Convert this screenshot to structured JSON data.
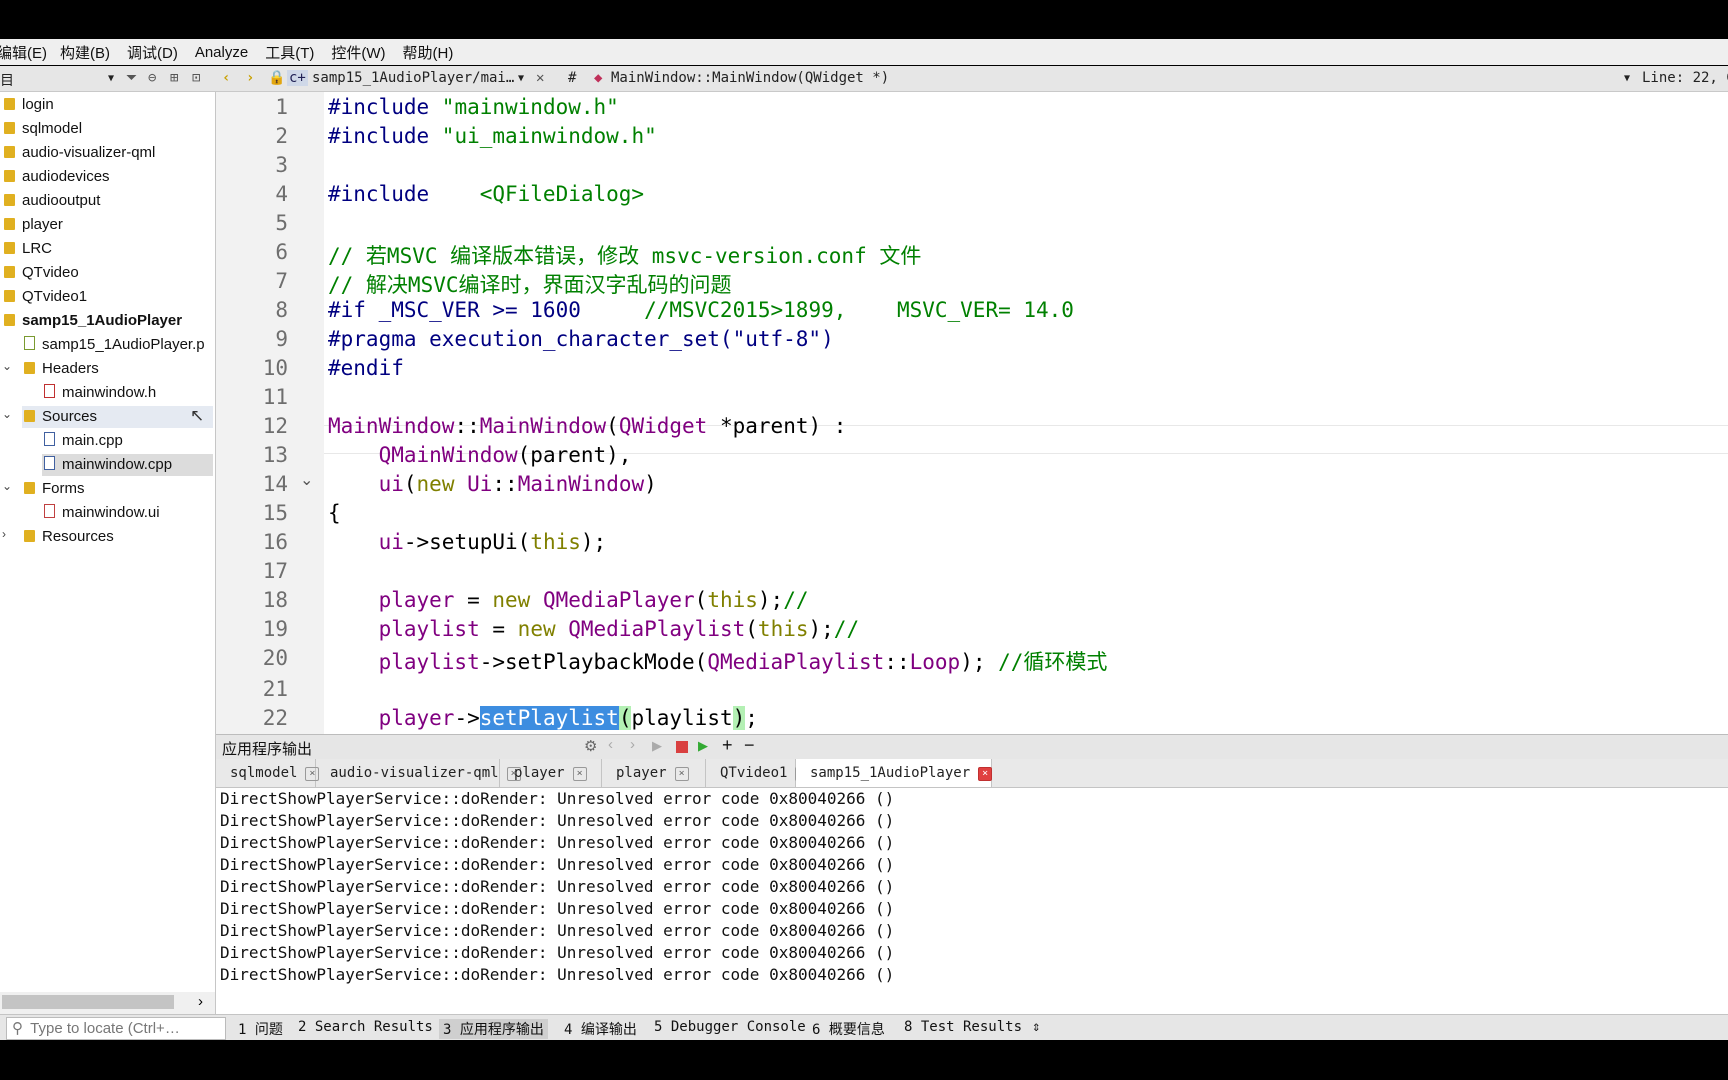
{
  "menu": [
    "编辑(E)",
    "构建(B)",
    "调试(D)",
    "Analyze",
    "工具(T)",
    "控件(W)",
    "帮助(H)"
  ],
  "toolbar": {
    "left_icon": "目",
    "file_tab": "samp15_1AudioPlayer/mai…",
    "hash": "#",
    "symbol": "MainWindow::MainWindow(QWidget *)",
    "position": "Line: 22, C"
  },
  "project_tree": [
    {
      "label": "login",
      "indent": 0,
      "icon": "folder-icon"
    },
    {
      "label": "sqlmodel",
      "indent": 0,
      "icon": "folder-icon"
    },
    {
      "label": "audio-visualizer-qml",
      "indent": 0,
      "icon": "folder-icon"
    },
    {
      "label": "audiodevices",
      "indent": 0,
      "icon": "folder-icon"
    },
    {
      "label": "audiooutput",
      "indent": 0,
      "icon": "folder-icon"
    },
    {
      "label": "player",
      "indent": 0,
      "icon": "folder-icon"
    },
    {
      "label": "LRC",
      "indent": 0,
      "icon": "folder-icon"
    },
    {
      "label": "QTvideo",
      "indent": 0,
      "icon": "folder-icon"
    },
    {
      "label": "QTvideo1",
      "indent": 0,
      "icon": "folder-icon"
    },
    {
      "label": "samp15_1AudioPlayer",
      "indent": 0,
      "icon": "folder-icon",
      "bold": true
    },
    {
      "label": "samp15_1AudioPlayer.p",
      "indent": 1,
      "icon": "pro-file-icon"
    },
    {
      "label": "Headers",
      "indent": 1,
      "icon": "headers-folder-icon",
      "chevron": "expanded"
    },
    {
      "label": "mainwindow.h",
      "indent": 2,
      "icon": "header-file-icon"
    },
    {
      "label": "Sources",
      "indent": 1,
      "icon": "sources-folder-icon",
      "chevron": "expanded",
      "hover": true
    },
    {
      "label": "main.cpp",
      "indent": 2,
      "icon": "cpp-file-icon"
    },
    {
      "label": "mainwindow.cpp",
      "indent": 2,
      "icon": "cpp-file-icon",
      "selected": true
    },
    {
      "label": "Forms",
      "indent": 1,
      "icon": "forms-folder-icon",
      "chevron": "expanded"
    },
    {
      "label": "mainwindow.ui",
      "indent": 2,
      "icon": "ui-file-icon"
    },
    {
      "label": "Resources",
      "indent": 1,
      "icon": "resources-folder-icon",
      "chevron": "collapsed"
    }
  ],
  "code_lines": [
    {
      "n": "1",
      "segs": [
        [
          "pp",
          "#include "
        ],
        [
          "str",
          "\"mainwindow.h\""
        ]
      ]
    },
    {
      "n": "2",
      "segs": [
        [
          "pp",
          "#include "
        ],
        [
          "str",
          "\"ui_mainwindow.h\""
        ]
      ]
    },
    {
      "n": "3",
      "segs": []
    },
    {
      "n": "4",
      "segs": [
        [
          "pp",
          "#include    "
        ],
        [
          "str",
          "<QFileDialog>"
        ]
      ]
    },
    {
      "n": "5",
      "segs": []
    },
    {
      "n": "6",
      "segs": [
        [
          "cm",
          "// 若MSVC 编译版本错误，修改 msvc-version.conf 文件"
        ]
      ]
    },
    {
      "n": "7",
      "segs": [
        [
          "cm",
          "// 解决MSVC编译时，界面汉字乱码的问题"
        ]
      ]
    },
    {
      "n": "8",
      "segs": [
        [
          "pp",
          "#if _MSC_VER >= 1600     "
        ],
        [
          "cm",
          "//MSVC2015>1899,    MSVC_VER= 14.0"
        ]
      ]
    },
    {
      "n": "9",
      "segs": [
        [
          "pp",
          "#pragma execution_character_set(\"utf-8\")"
        ]
      ]
    },
    {
      "n": "10",
      "segs": [
        [
          "pp",
          "#endif"
        ]
      ]
    },
    {
      "n": "11",
      "segs": []
    },
    {
      "n": "12",
      "segs": [
        [
          "ty",
          "MainWindow"
        ],
        [
          "",
          "::"
        ],
        [
          "ty",
          "MainWindow"
        ],
        [
          "",
          "("
        ],
        [
          "ty",
          "QWidget"
        ],
        [
          "",
          " *parent) :"
        ]
      ]
    },
    {
      "n": "13",
      "segs": [
        [
          "",
          "    "
        ],
        [
          "ty",
          "QMainWindow"
        ],
        [
          "",
          "(parent),"
        ]
      ]
    },
    {
      "n": "14",
      "segs": [
        [
          "",
          "    "
        ],
        [
          "ty",
          "ui"
        ],
        [
          "",
          "("
        ],
        [
          "kw",
          "new "
        ],
        [
          "ty",
          "Ui"
        ],
        [
          "",
          "::"
        ],
        [
          "ty",
          "MainWindow"
        ],
        [
          "",
          ")"
        ]
      ],
      "fold": true
    },
    {
      "n": "15",
      "segs": [
        [
          "",
          "{"
        ]
      ]
    },
    {
      "n": "16",
      "segs": [
        [
          "",
          "    "
        ],
        [
          "ty",
          "ui"
        ],
        [
          "",
          "->setupUi("
        ],
        [
          "kw",
          "this"
        ],
        [
          "",
          ");"
        ]
      ]
    },
    {
      "n": "17",
      "segs": []
    },
    {
      "n": "18",
      "segs": [
        [
          "",
          "    "
        ],
        [
          "ty",
          "player"
        ],
        [
          "",
          " = "
        ],
        [
          "kw",
          "new "
        ],
        [
          "ty",
          "QMediaPlayer"
        ],
        [
          "",
          "("
        ],
        [
          "kw",
          "this"
        ],
        [
          "",
          ");"
        ],
        [
          "cm",
          "//"
        ]
      ]
    },
    {
      "n": "19",
      "segs": [
        [
          "",
          "    "
        ],
        [
          "ty",
          "playlist"
        ],
        [
          "",
          " = "
        ],
        [
          "kw",
          "new "
        ],
        [
          "ty",
          "QMediaPlaylist"
        ],
        [
          "",
          "("
        ],
        [
          "kw",
          "this"
        ],
        [
          "",
          ");"
        ],
        [
          "cm",
          "//"
        ]
      ]
    },
    {
      "n": "20",
      "segs": [
        [
          "",
          "    "
        ],
        [
          "ty",
          "playlist"
        ],
        [
          "",
          "->setPlaybackMode("
        ],
        [
          "ty",
          "QMediaPlaylist"
        ],
        [
          "",
          "::"
        ],
        [
          "ty",
          "Loop"
        ],
        [
          "",
          "); "
        ],
        [
          "cm",
          "//循环模式"
        ]
      ]
    },
    {
      "n": "21",
      "segs": []
    },
    {
      "n": "22",
      "segs": [
        [
          "",
          "    "
        ],
        [
          "ty",
          "player"
        ],
        [
          "",
          "->"
        ],
        [
          "hl",
          "setPlaylist"
        ],
        [
          "bh",
          "("
        ],
        [
          "",
          "playlist"
        ],
        [
          "bh",
          ")"
        ],
        [
          "",
          ";"
        ]
      ]
    }
  ],
  "output_pane": {
    "title": "应用程序输出",
    "tabs": [
      {
        "label": "sqlmodel"
      },
      {
        "label": "audio-visualizer-qml"
      },
      {
        "label": "player"
      },
      {
        "label": "player"
      },
      {
        "label": "QTvideo1"
      },
      {
        "label": "samp15_1AudioPlayer",
        "active": true
      }
    ],
    "lines": [
      "DirectShowPlayerService::doRender: Unresolved error code 0x80040266 ()",
      "DirectShowPlayerService::doRender: Unresolved error code 0x80040266 ()",
      "DirectShowPlayerService::doRender: Unresolved error code 0x80040266 ()",
      "DirectShowPlayerService::doRender: Unresolved error code 0x80040266 ()",
      "DirectShowPlayerService::doRender: Unresolved error code 0x80040266 ()",
      "DirectShowPlayerService::doRender: Unresolved error code 0x80040266 ()",
      "DirectShowPlayerService::doRender: Unresolved error code 0x80040266 ()",
      "DirectShowPlayerService::doRender: Unresolved error code 0x80040266 ()",
      "DirectShowPlayerService::doRender: Unresolved error code 0x80040266 ()"
    ]
  },
  "statusbar": {
    "locate_placeholder": "Type to locate (Ctrl+…",
    "panes": [
      "1 问题",
      "2 Search Results",
      "3 应用程序输出",
      "4 编译输出",
      "5 Debugger Console",
      "6 概要信息",
      "8 Test Results"
    ],
    "active_pane": 2
  }
}
